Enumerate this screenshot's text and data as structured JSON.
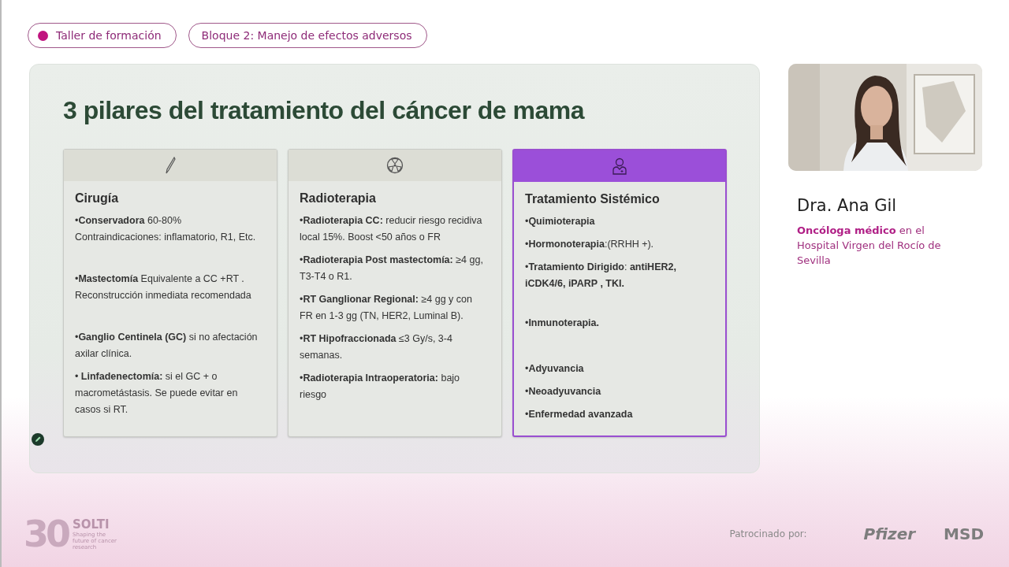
{
  "header_pills": [
    {
      "label": "Taller de formación",
      "dot": true
    },
    {
      "label": "Bloque 2: Manejo de efectos adversos",
      "dot": false
    }
  ],
  "slide": {
    "title": "3 pilares del tratamiento del cáncer de mama",
    "cards": [
      {
        "kind": "scalpel",
        "title": "Cirugía",
        "highlighted": false,
        "items": [
          "•**Conservadora** 60-80%\nContraindicaciones: inflamatorio, R1, Etc.",
          "•**Mastectomía** Equivalente a CC +RT . Reconstrucción inmediata recomendada",
          "•**Ganglio Centinela (GC)** si no afectación axilar clínica.",
          "• **Linfadenectomía:** si el GC + o macrometástasis. Se puede evitar en casos si RT."
        ]
      },
      {
        "kind": "radiation",
        "title": "Radioterapia",
        "highlighted": false,
        "items": [
          "•**Radioterapia CC:** reducir riesgo recidiva local 15%. Boost <50 años o FR",
          "•**Radioterapia Post mastectomía:** ≥4 gg, T3-T4 o R1.",
          "•**RT Ganglionar Regional:** ≥4 gg y con FR en 1-3 gg (TN, HER2, Luminal B).",
          "•**RT Hipofraccionada** ≤3 Gy/s, 3-4 semanas.",
          "•**Radioterapia Intraoperatoria:** bajo riesgo"
        ]
      },
      {
        "kind": "doctor",
        "title": "Tratamiento Sistémico",
        "highlighted": true,
        "items": [
          "•**Quimioterapia**",
          "•**Hormonoterapia**:(RRHH +).",
          "•**Tratamiento Dirigido**: **antiHER2, iCDK4/6, iPARP , TKI.**",
          "•**Inmunoterapia.**",
          "•**Adyuvancia**",
          "•**Neoadyuvancia**",
          "•**Enfermedad avanzada**"
        ]
      }
    ]
  },
  "speaker": {
    "name": "Dra. Ana Gil",
    "role": "**Oncóloga médico** en el Hospital Virgen del Rocío de Sevilla"
  },
  "footer": {
    "logo_number": "30",
    "logo_name": "SOLTI",
    "logo_tagline": "Shaping the future of cancer research",
    "sponsor_label": "Patrocinado por:",
    "sponsors": [
      "Pfizer",
      "MSD"
    ]
  }
}
